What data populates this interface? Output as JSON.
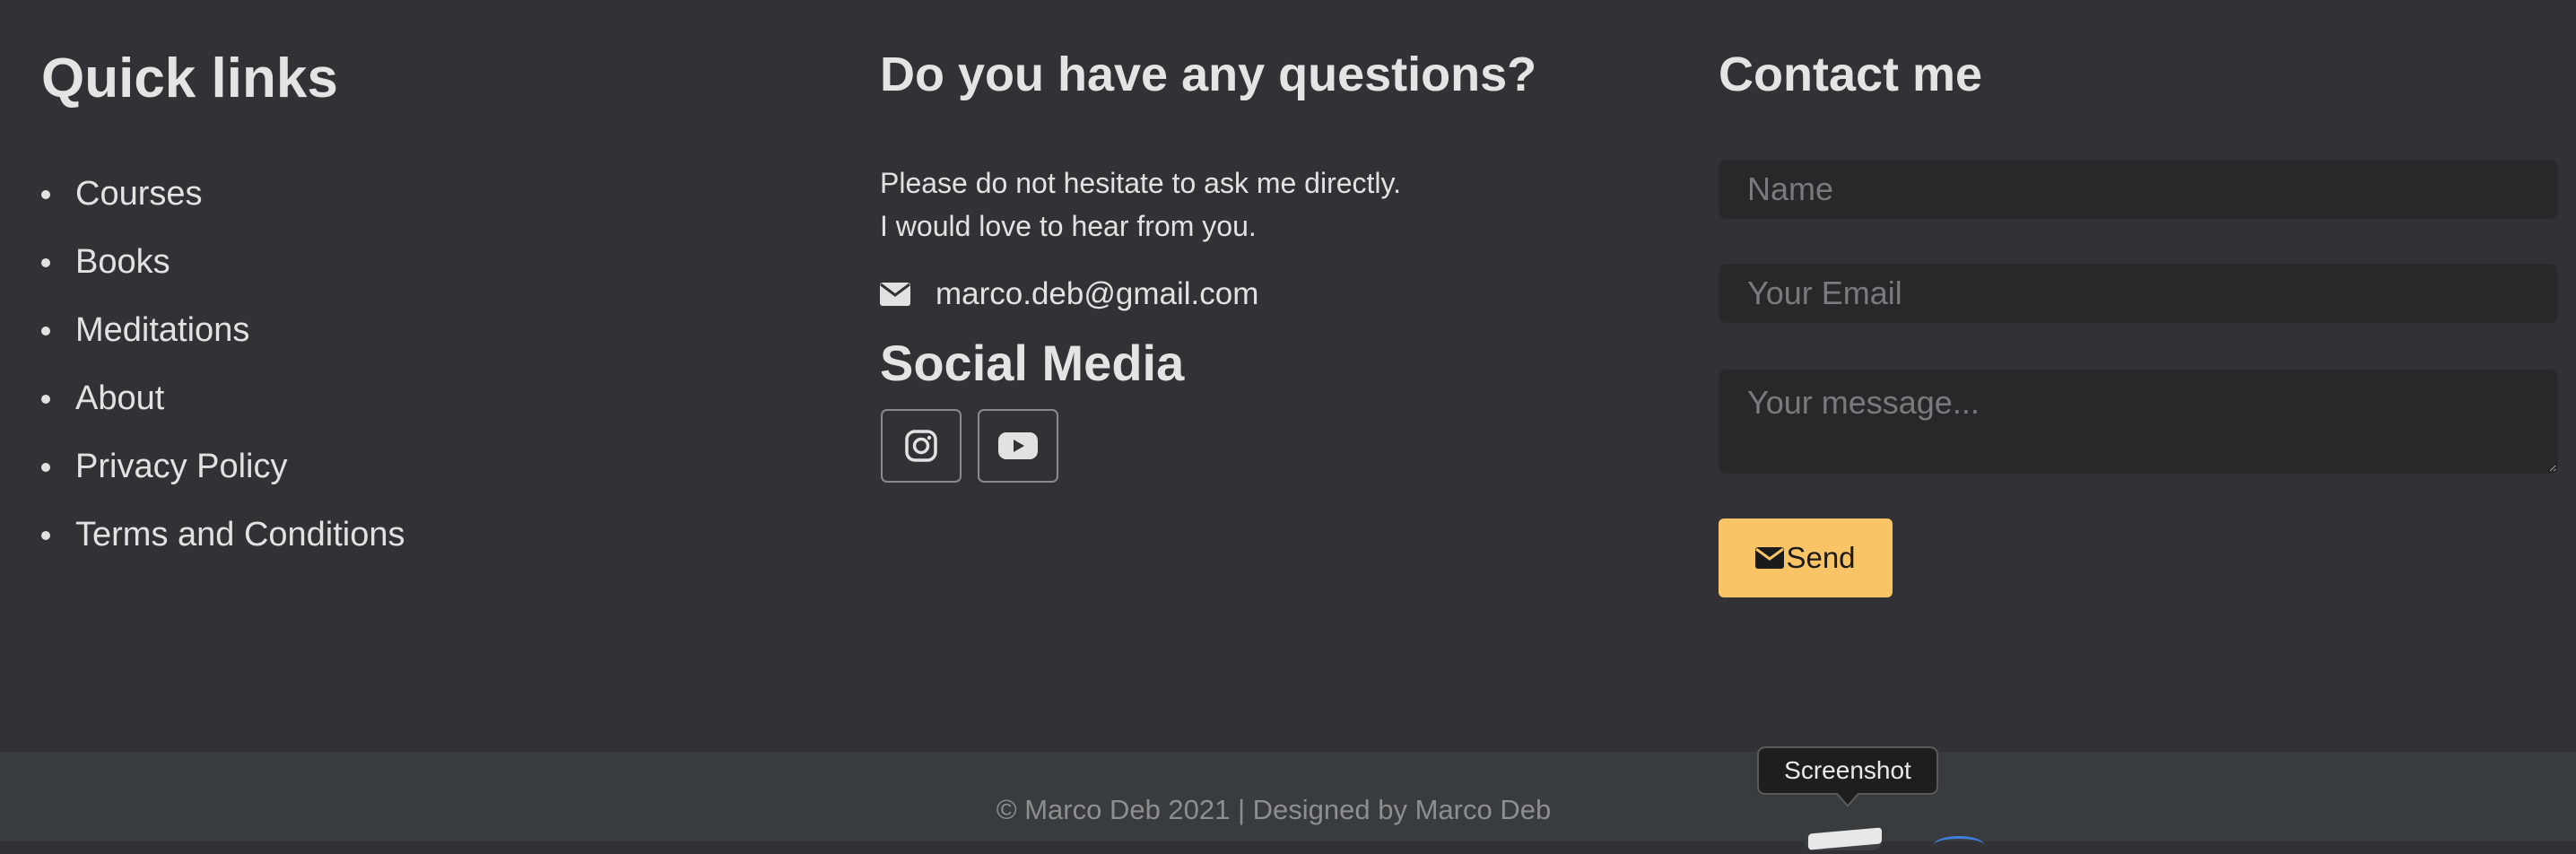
{
  "quick_links": {
    "title": "Quick links",
    "items": [
      "Courses",
      "Books",
      "Meditations",
      "About",
      "Privacy Policy",
      "Terms and Conditions"
    ]
  },
  "questions": {
    "title": "Do you have any questions?",
    "line1": "Please do not hesitate to ask me directly.",
    "line2": "I would love to hear from you.",
    "email": "marco.deb@gmail.com",
    "email_icon": "envelope-icon"
  },
  "social": {
    "title": "Social Media",
    "buttons": [
      {
        "icon": "instagram-icon"
      },
      {
        "icon": "youtube-icon"
      }
    ]
  },
  "contact": {
    "title": "Contact me",
    "name_placeholder": "Name",
    "email_placeholder": "Your Email",
    "message_placeholder": "Your message...",
    "send_label": "Send",
    "send_color": "#f8c465"
  },
  "footer": {
    "copyright": "© Marco Deb 2021 | Designed by Marco Deb"
  },
  "tooltip": {
    "label": "Screenshot"
  },
  "colors": {
    "background": "#323236",
    "footer_background": "#393c3e",
    "text": "#e2e2e2"
  }
}
